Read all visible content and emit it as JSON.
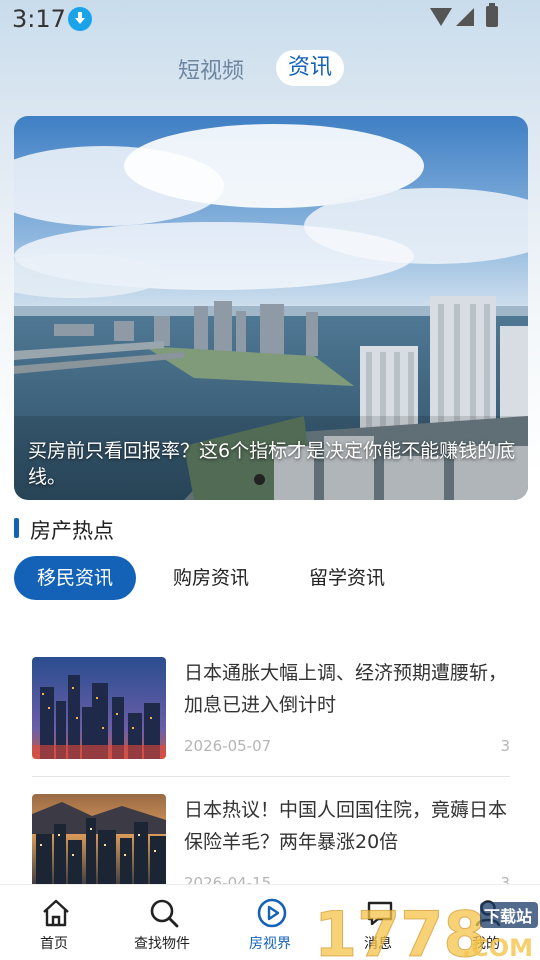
{
  "status_bar": {
    "time": "3:17"
  },
  "top_tabs": {
    "short_video": "短视频",
    "news": "资讯"
  },
  "banner": {
    "caption": "买房前只看回报率？这6个指标才是决定你能不能赚钱的底线。"
  },
  "section": {
    "title": "房产热点"
  },
  "category_tabs": [
    "移民资讯",
    "购房资讯",
    "留学资讯"
  ],
  "news": [
    {
      "title": "日本通胀大幅上调、经济预期遭腰斩，加息已进入倒计时",
      "date": "2026-05-07",
      "count": "3"
    },
    {
      "title": "日本热议！中国人回国住院，竟薅日本保险羊毛？两年暴涨20倍",
      "date": "2026-04-15",
      "count": "3"
    }
  ],
  "bottom_nav": [
    {
      "label": "首页",
      "icon": "home-icon"
    },
    {
      "label": "查找物件",
      "icon": "search-icon"
    },
    {
      "label": "房视界",
      "icon": "play-circle-icon"
    },
    {
      "label": "消息",
      "icon": "message-icon"
    },
    {
      "label": "我的",
      "icon": "user-icon"
    }
  ],
  "watermark": {
    "text": "1778",
    "suffix": "下载站",
    "domain": ".COM"
  },
  "colors": {
    "accent": "#1462b8",
    "status_download": "#1aa3e8"
  }
}
